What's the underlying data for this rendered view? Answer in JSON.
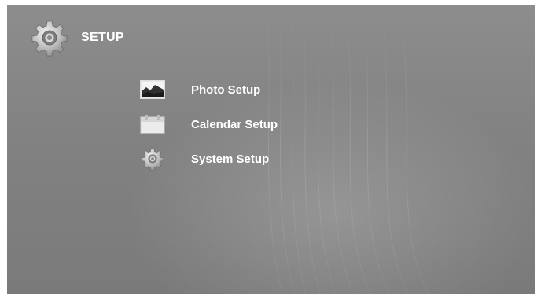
{
  "header": {
    "title": "SETUP",
    "icon": "gear-icon"
  },
  "menu": {
    "items": [
      {
        "label": "Photo Setup",
        "icon": "photo-icon"
      },
      {
        "label": "Calendar Setup",
        "icon": "calendar-icon"
      },
      {
        "label": "System Setup",
        "icon": "gear-icon"
      }
    ]
  },
  "colors": {
    "background": "#858585",
    "text": "#ffffff"
  }
}
